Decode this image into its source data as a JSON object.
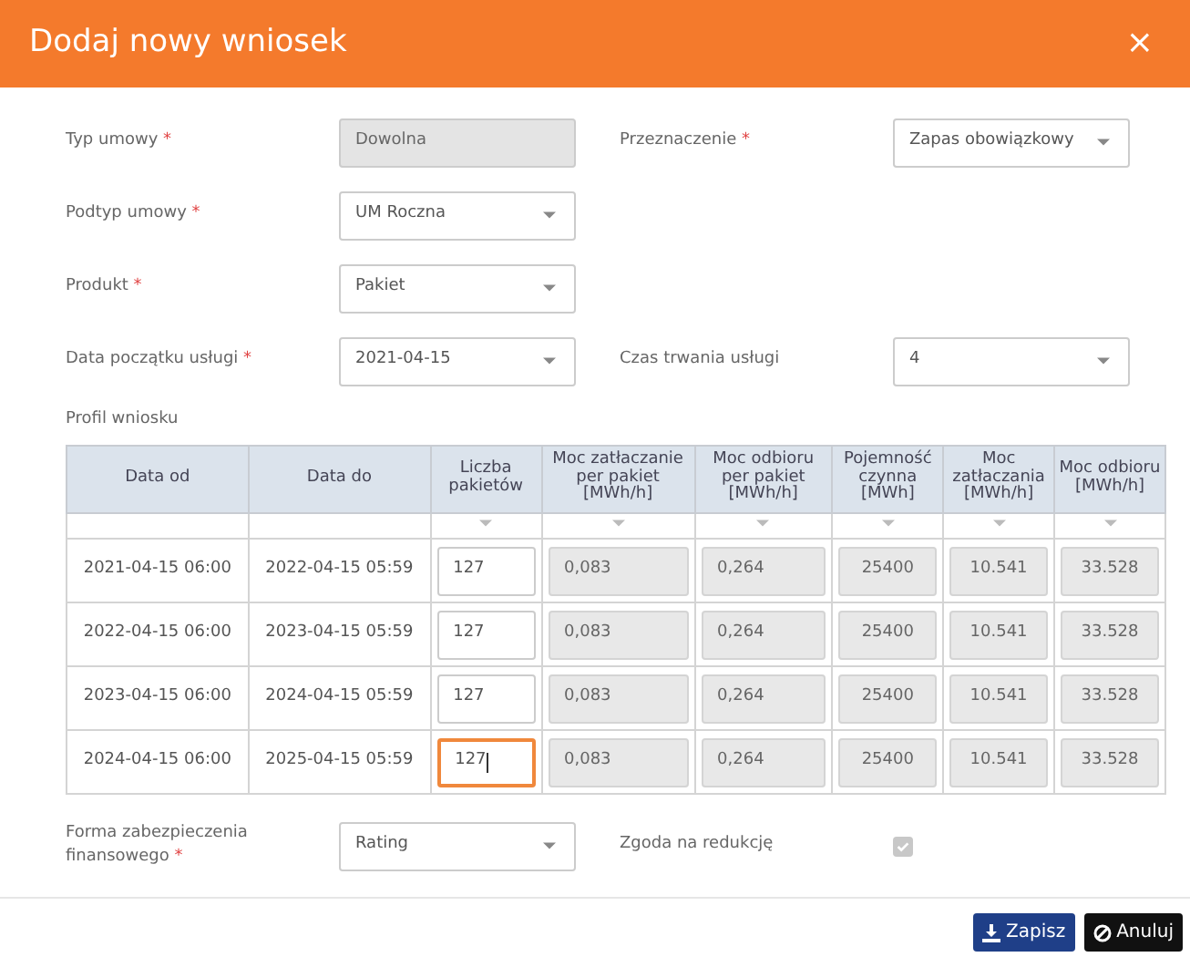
{
  "window": {
    "title": "Dodaj nowy wniosek",
    "close": "×"
  },
  "form_rows": [
    {
      "fields": [
        {
          "label": "Typ umowy",
          "required_mark": "*",
          "kind": "readonly",
          "value": "Dowolna"
        },
        {
          "label": "Przeznaczenie",
          "required_mark": "*",
          "kind": "select",
          "value": "Zapas obowiązkowy"
        }
      ]
    },
    {
      "fields": [
        {
          "label": "Podtyp umowy",
          "required_mark": "*",
          "kind": "select",
          "value": "UM Roczna"
        }
      ]
    },
    {
      "fields": [
        {
          "label": "Produkt",
          "required_mark": "*",
          "kind": "select",
          "value": "Pakiet"
        }
      ]
    },
    {
      "fields": [
        {
          "label": "Data początku usługi",
          "required_mark": "*",
          "kind": "select",
          "value": "2021-04-15"
        },
        {
          "label": "Czas trwania usługi",
          "kind": "select",
          "value": "4"
        }
      ]
    }
  ],
  "profile": {
    "title": "Profil wniosku",
    "columns": [
      "Data od",
      "Data do",
      "Liczba pakietów",
      "Moc zatłaczanie per pakiet [MWh/h]",
      "Moc odbioru per pakiet [MWh/h]",
      "Pojemność czynna [MWh]",
      "Moc zatłaczania [MWh/h]",
      "Moc odbioru [MWh/h]"
    ],
    "rows": [
      {
        "date_from": "2021-04-15 06:00",
        "date_to": "2022-04-15 05:59",
        "packets": "127",
        "focused": false,
        "values": [
          "0,083",
          "0,264",
          "25400",
          "10.541",
          "33.528"
        ]
      },
      {
        "date_from": "2022-04-15 06:00",
        "date_to": "2023-04-15 05:59",
        "packets": "127",
        "focused": false,
        "values": [
          "0,083",
          "0,264",
          "25400",
          "10.541",
          "33.528"
        ]
      },
      {
        "date_from": "2023-04-15 06:00",
        "date_to": "2024-04-15 05:59",
        "packets": "127",
        "focused": false,
        "values": [
          "0,083",
          "0,264",
          "25400",
          "10.541",
          "33.528"
        ]
      },
      {
        "date_from": "2024-04-15 06:00",
        "date_to": "2025-04-15 05:59",
        "packets": "127",
        "focused": true,
        "values": [
          "0,083",
          "0,264",
          "25400",
          "10.541",
          "33.528"
        ]
      }
    ]
  },
  "security": {
    "label": "Forma zabezpieczenia finansowego",
    "required_mark": "*",
    "value": "Rating"
  },
  "reduction": {
    "label": "Zgoda na redukcję",
    "checked": true,
    "disabled": true
  },
  "buttons": [
    {
      "label": "Zapisz",
      "kind": "save"
    },
    {
      "label": "Anuluj",
      "kind": "cancel"
    }
  ]
}
